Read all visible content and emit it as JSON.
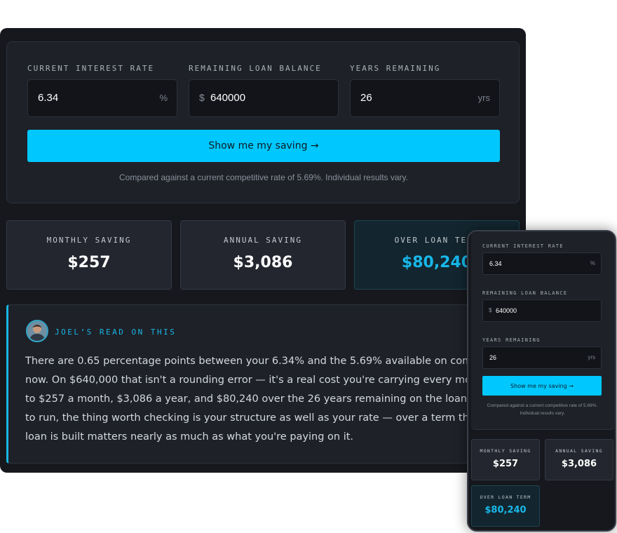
{
  "colors": {
    "accent": "#00c8ff",
    "highlight": "#19b6e6",
    "background": "#16181d"
  },
  "form": {
    "rate_label": "CURRENT INTEREST RATE",
    "rate_value": "6.34",
    "rate_suffix": "%",
    "balance_label": "REMAINING LOAN BALANCE",
    "balance_prefix": "$",
    "balance_value": "640000",
    "years_label": "YEARS REMAINING",
    "years_value": "26",
    "years_suffix": "yrs",
    "submit_label": "Show me my saving →",
    "note": "Compared against a current competitive rate of 5.69%. Individual results vary.",
    "note_mobile_line1": "Compared against a current competitive rate of 5.69%.",
    "note_mobile_line2": "Individual results vary."
  },
  "results": {
    "monthly_label": "MONTHLY SAVING",
    "monthly_value": "$257",
    "annual_label": "ANNUAL SAVING",
    "annual_value": "$3,086",
    "term_label": "OVER LOAN TERM",
    "term_value": "$80,240"
  },
  "commentary": {
    "title": "JOEL’S READ ON THIS",
    "avatar_icon": "person-avatar-icon",
    "body": "There are 0.65 percentage points between your 6.34% and the 5.69% available on comparable loans right now. On $640,000 that isn't a rounding error — it's a real cost you're carrying every month. That works out to $257 a month, $3,086 a year, and $80,240 over the 26 years remaining on the loan. With 26 years left to run, the thing worth checking is your structure as well as your rate — over a term that long, how the loan is built matters nearly as much as what you're paying on it."
  }
}
